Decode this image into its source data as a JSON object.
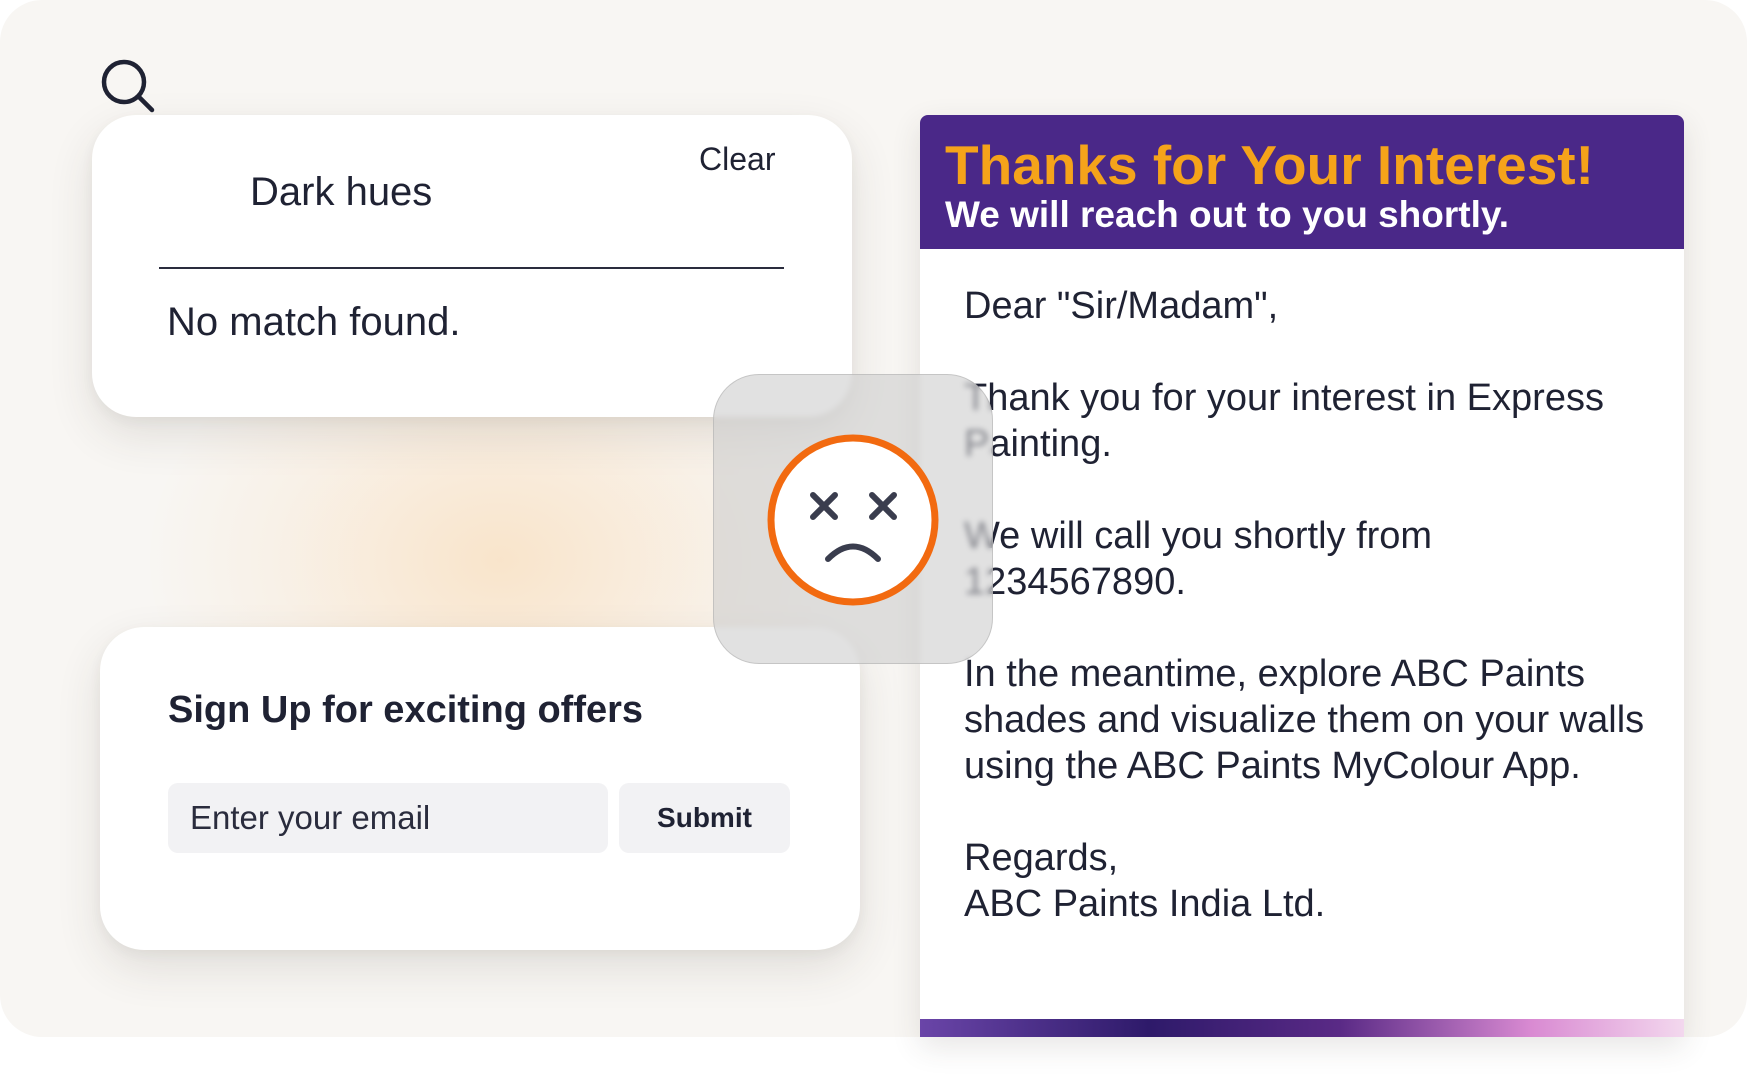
{
  "search": {
    "query": "Dark hues",
    "clear_label": "Clear",
    "result_message": "No match found."
  },
  "signup": {
    "title": "Sign Up for exciting offers",
    "email_placeholder": "Enter your email",
    "submit_label": "Submit"
  },
  "letter": {
    "title": "Thanks for Your Interest!",
    "subtitle": "We will reach out to you shortly.",
    "greeting": "Dear \"Sir/Madam\",",
    "paragraph1": "Thank you for your interest in Express Painting.",
    "paragraph2": "We will call you shortly from 1234567890.",
    "paragraph3": "In the meantime, explore ABC Paints shades and visualize them on your walls using the ABC Paints MyColour App.",
    "signoff": "Regards,",
    "company": "ABC Paints India Ltd."
  },
  "colors": {
    "header_bg": "#4a2888",
    "title_accent": "#f5a31a",
    "error_orange": "#f26a10"
  },
  "icons": {
    "search": "search-icon",
    "error_face": "sad-face-icon"
  }
}
